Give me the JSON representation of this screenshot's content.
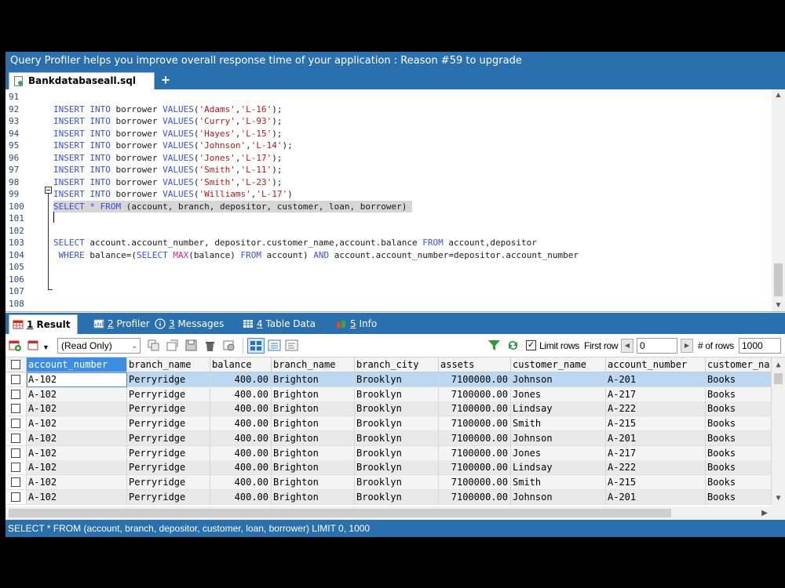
{
  "banner": {
    "text": "Query Profiler helps you improve overall response time of your application : Reason #59 to upgrade"
  },
  "file_tab": {
    "label": "Bankdatabaseall.sql",
    "add_label": "+"
  },
  "editor": {
    "line_numbers": [
      "91",
      "92",
      "93",
      "94",
      "95",
      "96",
      "97",
      "98",
      "99",
      "100",
      "101",
      "102",
      "103",
      "104",
      "105",
      "106",
      "107",
      "108"
    ],
    "insert_lines": [
      {
        "name": "Adams",
        "loan": "L-16",
        "term": ";"
      },
      {
        "name": "Curry",
        "loan": "L-93",
        "term": ";"
      },
      {
        "name": "Hayes",
        "loan": "L-15",
        "term": ";"
      },
      {
        "name": "Johnson",
        "loan": "L-14",
        "term": ";"
      },
      {
        "name": "Jones",
        "loan": "L-17",
        "term": ";"
      },
      {
        "name": "Smith",
        "loan": "L-11",
        "term": ";"
      },
      {
        "name": "Smith",
        "loan": "L-23",
        "term": ";"
      },
      {
        "name": "Williams",
        "loan": "L-17",
        "term": ""
      }
    ],
    "kw_insert": "INSERT",
    "kw_into": "INTO",
    "table_borrower": "borrower",
    "kw_values": "VALUES",
    "kw_select": "SELECT",
    "kw_from": "FROM",
    "kw_where": "WHERE",
    "kw_and": "AND",
    "fn_max": "MAX",
    "line100_rest": " * ",
    "line100_tables": " (account, branch, depositor, customer, loan, borrower) ",
    "line103_cols": " account.account_number, depositor.customer_name,account.balance ",
    "line103_tables": " account,depositor",
    "line104_a": " balance=(",
    "line104_b": "(balance) ",
    "line104_c": " account) ",
    "line104_d": " account.account_number=depositor.account_number"
  },
  "result_tabs": [
    {
      "num": "1",
      "label": " Result"
    },
    {
      "num": "2",
      "label": " Profiler"
    },
    {
      "num": "3",
      "label": " Messages"
    },
    {
      "num": "4",
      "label": " Table Data"
    },
    {
      "num": "5",
      "label": " Info"
    }
  ],
  "toolbar": {
    "read_only": "(Read Only)",
    "limit_rows": "Limit rows",
    "first_row_label": "First row",
    "first_row_value": "0",
    "num_rows_label": "# of rows",
    "num_rows_value": "1000",
    "check_mark": "✓"
  },
  "grid": {
    "columns": [
      "account_number",
      "branch_name",
      "balance",
      "branch_name",
      "branch_city",
      "assets",
      "customer_name",
      "account_number",
      "customer_na"
    ],
    "rows": [
      [
        "A-102",
        "Perryridge",
        "400.00",
        "Brighton",
        "Brooklyn",
        "7100000.00",
        "Johnson",
        "A-201",
        "Books"
      ],
      [
        "A-102",
        "Perryridge",
        "400.00",
        "Brighton",
        "Brooklyn",
        "7100000.00",
        "Jones",
        "A-217",
        "Books"
      ],
      [
        "A-102",
        "Perryridge",
        "400.00",
        "Brighton",
        "Brooklyn",
        "7100000.00",
        "Lindsay",
        "A-222",
        "Books"
      ],
      [
        "A-102",
        "Perryridge",
        "400.00",
        "Brighton",
        "Brooklyn",
        "7100000.00",
        "Smith",
        "A-215",
        "Books"
      ],
      [
        "A-102",
        "Perryridge",
        "400.00",
        "Brighton",
        "Brooklyn",
        "7100000.00",
        "Johnson",
        "A-201",
        "Books"
      ],
      [
        "A-102",
        "Perryridge",
        "400.00",
        "Brighton",
        "Brooklyn",
        "7100000.00",
        "Jones",
        "A-217",
        "Books"
      ],
      [
        "A-102",
        "Perryridge",
        "400.00",
        "Brighton",
        "Brooklyn",
        "7100000.00",
        "Lindsay",
        "A-222",
        "Books"
      ],
      [
        "A-102",
        "Perryridge",
        "400.00",
        "Brighton",
        "Brooklyn",
        "7100000.00",
        "Smith",
        "A-215",
        "Books"
      ],
      [
        "A-102",
        "Perryridge",
        "400.00",
        "Brighton",
        "Brooklyn",
        "7100000.00",
        "Johnson",
        "A-201",
        "Books"
      ]
    ]
  },
  "status": {
    "text": "SELECT * FROM (account, branch, depositor, customer, loan, borrower) LIMIT 0, 1000"
  },
  "colors": {
    "accent": "#2a6fae",
    "header_selected": "#3d8ee0",
    "keyword": "#3a4fe0",
    "string": "#b01818",
    "function": "#e02090"
  }
}
